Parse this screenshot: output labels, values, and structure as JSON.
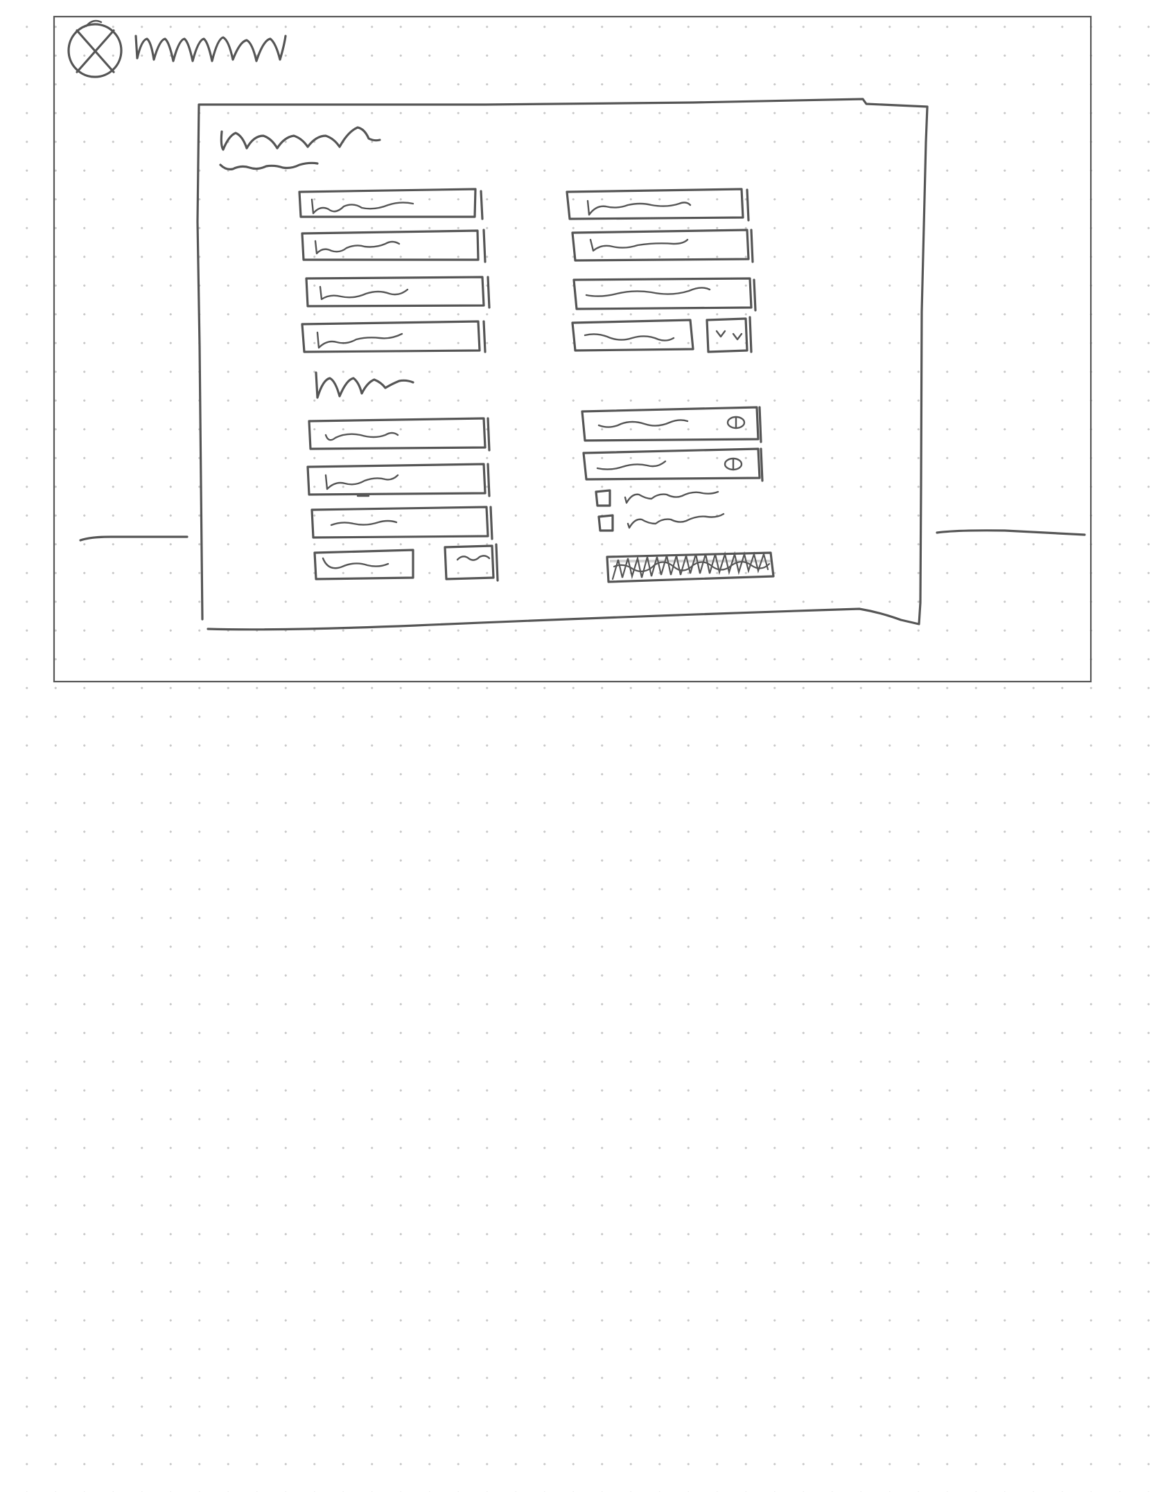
{
  "sketch": {
    "kind": "hand-drawn wireframe",
    "ink_color": "#555555",
    "background": "#ffffff",
    "dot_grid_color": "#c9c9c9",
    "app_icon": "close-circle-icon",
    "field_icons": [
      "eye-icon",
      "chevron-down-icon",
      "checkbox-icon"
    ]
  }
}
